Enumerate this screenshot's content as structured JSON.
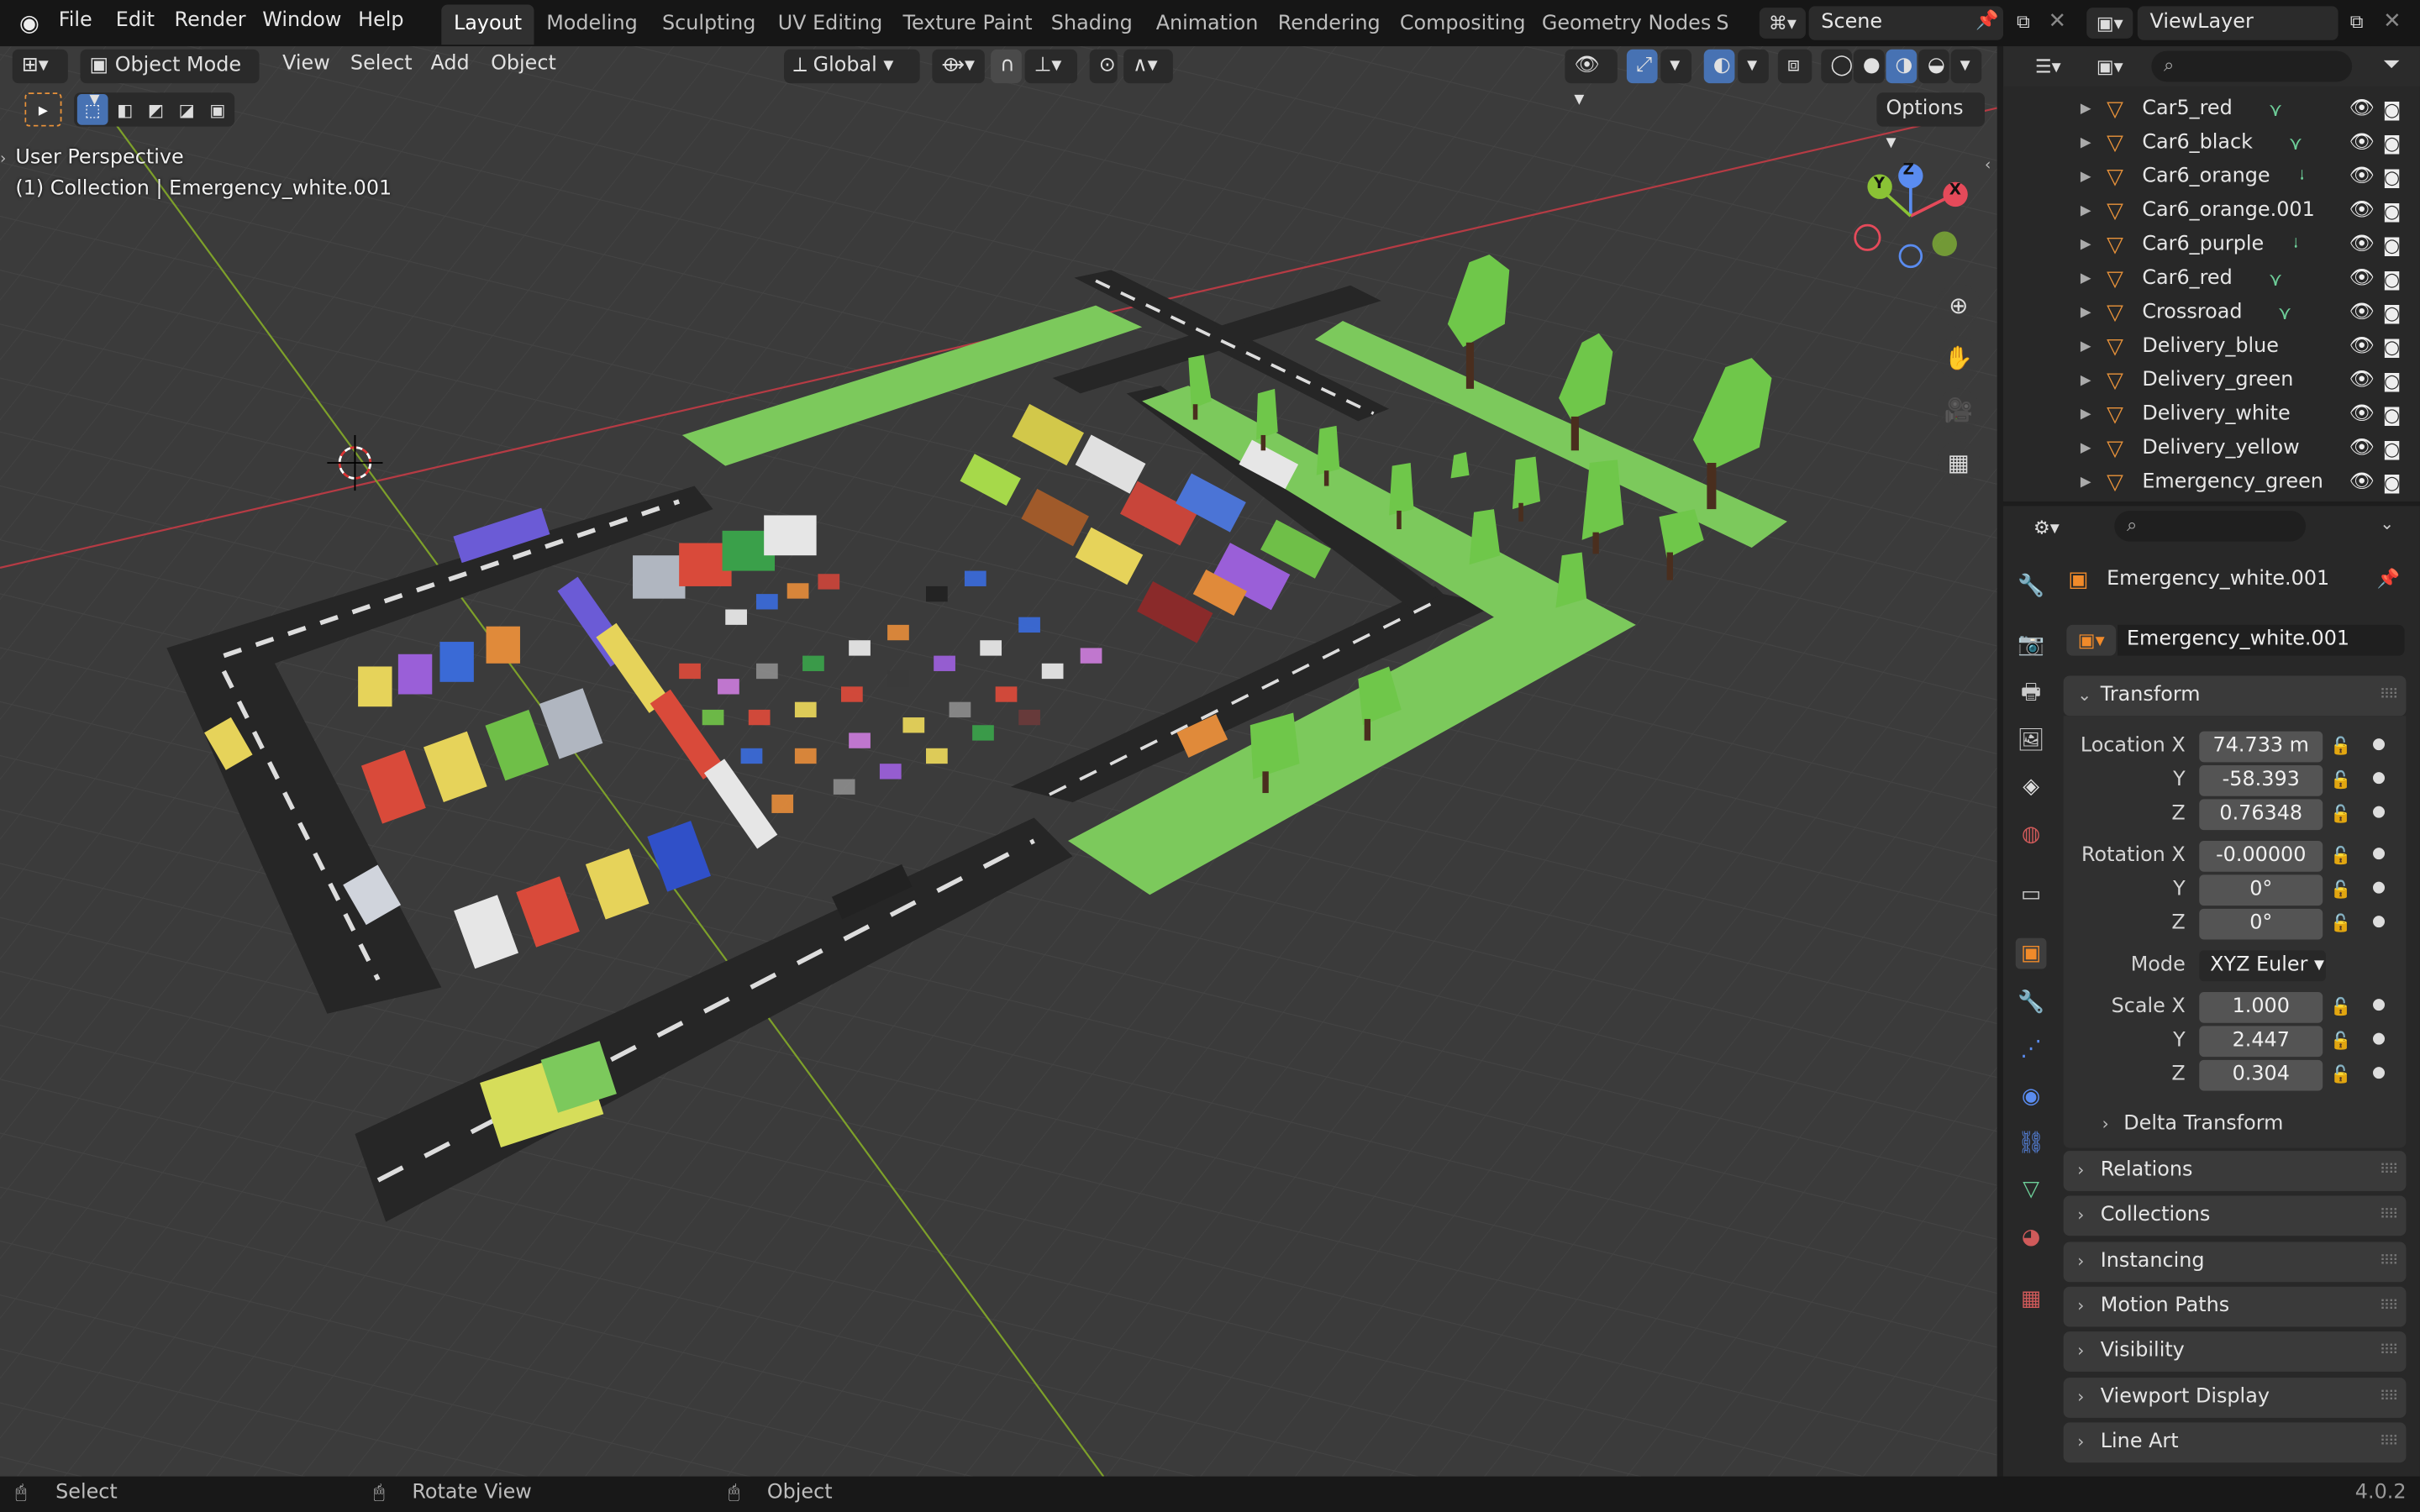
{
  "menu": {
    "file": "File",
    "edit": "Edit",
    "render": "Render",
    "window": "Window",
    "help": "Help"
  },
  "workspaces": [
    "Layout",
    "Modeling",
    "Sculpting",
    "UV Editing",
    "Texture Paint",
    "Shading",
    "Animation",
    "Rendering",
    "Compositing",
    "Geometry Nodes",
    "S"
  ],
  "scene": {
    "label": "Scene"
  },
  "view_layer": {
    "label": "ViewLayer"
  },
  "viewport_header": {
    "mode": "Object Mode",
    "view": "View",
    "select": "Select",
    "add": "Add",
    "object": "Object",
    "orientation": "Global",
    "options": "Options"
  },
  "viewport": {
    "perspective": "User Perspective",
    "collection_info": "(1) Collection | Emergency_white.001"
  },
  "gizmo": {
    "x": "X",
    "y": "Y",
    "z": "Z"
  },
  "outliner": {
    "items": [
      {
        "name": "Car5_red"
      },
      {
        "name": "Car6_black"
      },
      {
        "name": "Car6_orange"
      },
      {
        "name": "Car6_orange.001"
      },
      {
        "name": "Car6_purple"
      },
      {
        "name": "Car6_red"
      },
      {
        "name": "Crossroad"
      },
      {
        "name": "Delivery_blue"
      },
      {
        "name": "Delivery_green"
      },
      {
        "name": "Delivery_white"
      },
      {
        "name": "Delivery_yellow"
      },
      {
        "name": "Emergency_green"
      }
    ]
  },
  "properties": {
    "object_name": "Emergency_white.001",
    "datablock_name": "Emergency_white.001",
    "transform": {
      "title": "Transform",
      "location_label": "Location X",
      "location": {
        "x": "74.733 m",
        "y": "-58.393",
        "z": "0.76348"
      },
      "rotation_label": "Rotation X",
      "rotation": {
        "x": "-0.00000",
        "y": "0°",
        "z": "0°"
      },
      "mode_label": "Mode",
      "mode": "XYZ Euler",
      "scale_label": "Scale X",
      "scale": {
        "x": "1.000",
        "y": "2.447",
        "z": "0.304"
      },
      "y_label": "Y",
      "z_label": "Z",
      "delta": "Delta Transform"
    },
    "panels": [
      "Relations",
      "Collections",
      "Instancing",
      "Motion Paths",
      "Visibility",
      "Viewport Display",
      "Line Art"
    ]
  },
  "status": {
    "select": "Select",
    "rotate": "Rotate View",
    "object": "Object",
    "version": "4.0.2"
  },
  "colors": {
    "grass": "#7cc95c",
    "road": "#2b2b2b",
    "accent": "#4772b3",
    "object_orange": "#e8923a"
  }
}
